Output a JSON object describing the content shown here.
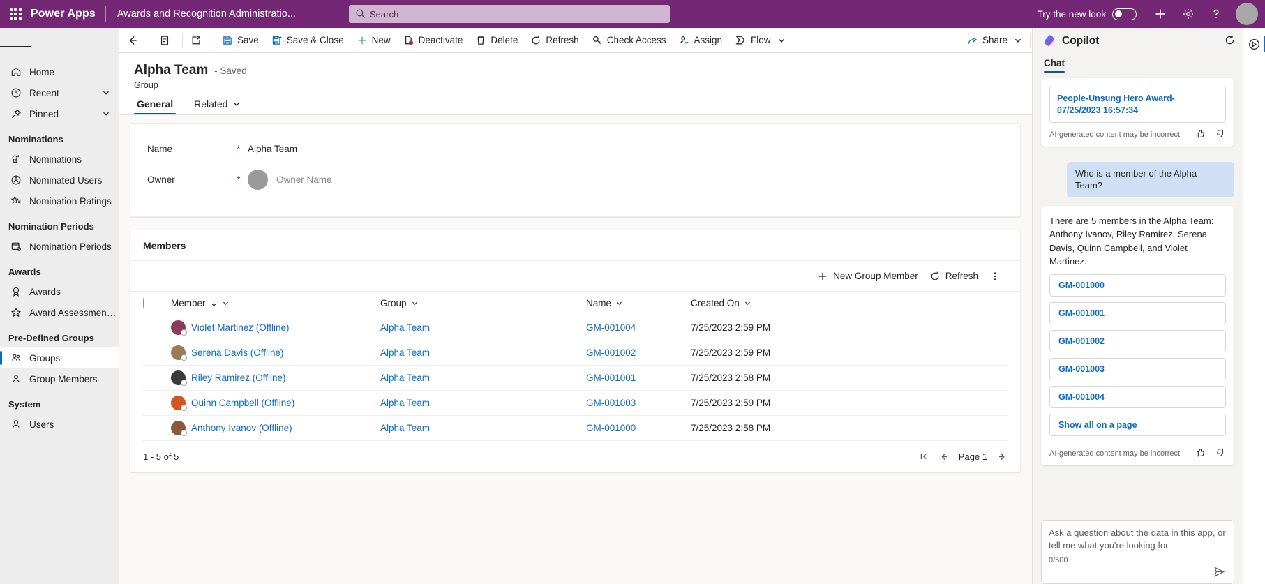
{
  "topbar": {
    "waffle_label": "App launcher",
    "brand": "Power Apps",
    "app_name": "Awards and Recognition Administratio...",
    "search_placeholder": "Search",
    "search_value": "",
    "try_new_look": "Try the new look",
    "toggle_state": "off",
    "plus_label": "Create",
    "gear_label": "Settings",
    "help_label": "Help"
  },
  "sidebar": {
    "menu_label": "Site map",
    "items": [
      {
        "label": "Home",
        "icon": "home-icon",
        "chevron": false
      },
      {
        "label": "Recent",
        "icon": "clock-icon",
        "chevron": true
      },
      {
        "label": "Pinned",
        "icon": "pin-icon",
        "chevron": true
      }
    ],
    "groups": [
      {
        "title": "Nominations",
        "items": [
          {
            "label": "Nominations",
            "icon": "ribbon-add-icon"
          },
          {
            "label": "Nominated Users",
            "icon": "person-badge-icon"
          },
          {
            "label": "Nomination Ratings",
            "icon": "star-list-icon"
          }
        ]
      },
      {
        "title": "Nomination Periods",
        "items": [
          {
            "label": "Nomination Periods",
            "icon": "calendar-clock-icon"
          }
        ]
      },
      {
        "title": "Awards",
        "items": [
          {
            "label": "Awards",
            "icon": "award-icon"
          },
          {
            "label": "Award Assessment R...",
            "icon": "star-icon"
          }
        ]
      },
      {
        "title": "Pre-Defined Groups",
        "items": [
          {
            "label": "Groups",
            "icon": "people-icon",
            "selected": true
          },
          {
            "label": "Group Members",
            "icon": "person-icon"
          }
        ]
      },
      {
        "title": "System",
        "items": [
          {
            "label": "Users",
            "icon": "person-icon"
          }
        ]
      }
    ]
  },
  "commandbar": {
    "back_label": "Back",
    "form_label": "Form selector",
    "popout_label": "Open in new window",
    "buttons": [
      {
        "label": "Save",
        "icon": "save-icon"
      },
      {
        "label": "Save & Close",
        "icon": "save-close-icon"
      },
      {
        "label": "New",
        "icon": "plus-icon"
      },
      {
        "label": "Deactivate",
        "icon": "deactivate-icon"
      },
      {
        "label": "Delete",
        "icon": "trash-icon"
      },
      {
        "label": "Refresh",
        "icon": "refresh-icon"
      },
      {
        "label": "Check Access",
        "icon": "key-icon"
      },
      {
        "label": "Assign",
        "icon": "assign-icon"
      },
      {
        "label": "Flow",
        "icon": "flow-icon",
        "chevron": true
      }
    ],
    "overflow_label": "More commands",
    "share_label": "Share"
  },
  "form": {
    "record_name": "Alpha Team",
    "record_state": "- Saved",
    "record_type": "Group",
    "tabs": [
      {
        "label": "General",
        "active": true,
        "chevron": false
      },
      {
        "label": "Related",
        "active": false,
        "chevron": true
      }
    ],
    "fields": [
      {
        "label": "Name",
        "required": "*",
        "value": "Alpha Team",
        "placeholder": false
      },
      {
        "label": "Owner",
        "required": "*",
        "value": "Owner Name",
        "placeholder": true
      }
    ]
  },
  "subgrid": {
    "title": "Members",
    "new_label": "New Group Member",
    "refresh_label": "Refresh",
    "overflow_label": "More grid commands",
    "select_all_label": "Select all rows",
    "columns": [
      {
        "label": "Member",
        "sorted": true
      },
      {
        "label": "Group",
        "sorted": false
      },
      {
        "label": "Name",
        "sorted": false
      },
      {
        "label": "Created On",
        "sorted": false
      }
    ],
    "rows": [
      {
        "member": "Violet Martinez (Offline)",
        "group": "Alpha Team",
        "name": "GM-001004",
        "created_on": "7/25/2023 2:59 PM",
        "avatar_color": "#8a3b5e"
      },
      {
        "member": "Serena Davis (Offline)",
        "group": "Alpha Team",
        "name": "GM-001002",
        "created_on": "7/25/2023 2:59 PM",
        "avatar_color": "#9c7a55"
      },
      {
        "member": "Riley Ramirez (Offline)",
        "group": "Alpha Team",
        "name": "GM-001001",
        "created_on": "7/25/2023 2:58 PM",
        "avatar_color": "#3b3b3b"
      },
      {
        "member": "Quinn Campbell (Offline)",
        "group": "Alpha Team",
        "name": "GM-001003",
        "created_on": "7/25/2023 2:59 PM",
        "avatar_color": "#d4561f"
      },
      {
        "member": "Anthony Ivanov (Offline)",
        "group": "Alpha Team",
        "name": "GM-001000",
        "created_on": "7/25/2023 2:58 PM",
        "avatar_color": "#8a5a3b"
      }
    ],
    "footer_count": "1 - 5 of 5",
    "page_label": "Page 1",
    "first_page_label": "First page",
    "prev_page_label": "Previous page",
    "next_page_label": "Next page"
  },
  "copilot": {
    "title": "Copilot",
    "refresh_label": "Refresh chat",
    "tab": "Chat",
    "citation": "People-Unsung Hero Award-07/25/2023 16:57:34",
    "disclaimer": "AI-generated content may be incorrect",
    "thumbs_up_label": "Like",
    "thumbs_down_label": "Dislike",
    "user_message": "Who is a member of the Alpha Team?",
    "ai_response": "There are 5 members in the Alpha Team: Anthony Ivanov, Riley Ramirez, Serena Davis, Quinn Campbell, and Violet Martinez.",
    "chips": [
      "GM-001000",
      "GM-001001",
      "GM-001002",
      "GM-001003",
      "GM-001004",
      "Show all on a page"
    ],
    "disclaimer2": "AI-generated content may be incorrect",
    "input_placeholder": "Ask a question about the data in this app, or tell me what you're looking for",
    "char_count": "0/500",
    "send_label": "Send"
  },
  "rail": {
    "copilot_label": "Copilot"
  },
  "colors": {
    "brand_purple": "#742774",
    "link_blue": "#0f6cbd",
    "accent_underline": "#0f548c",
    "required_red": "#a4262c",
    "user_bubble": "#cfe0f4"
  }
}
